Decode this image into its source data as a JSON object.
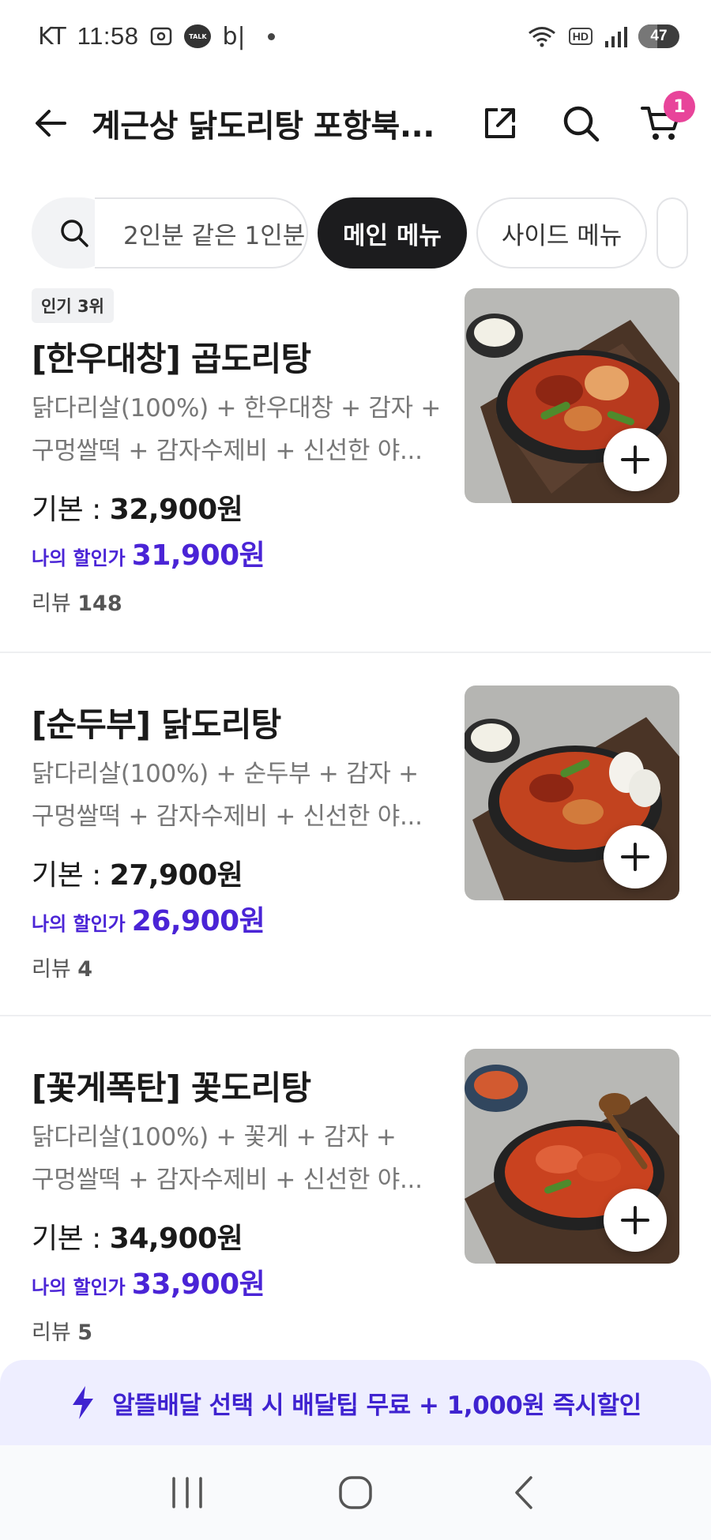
{
  "status_bar": {
    "carrier": "KT",
    "time": "11:58",
    "talk_label": "TALK",
    "app_label": "b|",
    "hd_label": "HD",
    "battery_level": "47"
  },
  "header": {
    "title": "계근상 닭도리탕 포항북...",
    "cart_count": "1"
  },
  "chips": {
    "items": [
      {
        "label": "2인분 같은 1인분."
      },
      {
        "label": "메인 메뉴"
      },
      {
        "label": "사이드 메뉴"
      }
    ],
    "active_index": 1
  },
  "menu": [
    {
      "rank": "인기 3위",
      "name": "[한우대창] 곱도리탕",
      "desc_line1": "닭다리살(100%) + 한우대창 + 감자 +",
      "desc_line2": "구멍쌀떡 + 감자수제비 + 신선한 야...",
      "base_label": "기본 : ",
      "base_price": "32,900원",
      "discount_label": "나의 할인가",
      "discount_price": "31,900원",
      "review_label": "리뷰 ",
      "review_count": "148"
    },
    {
      "rank": "",
      "name": "[순두부] 닭도리탕",
      "desc_line1": "닭다리살(100%) + 순두부 + 감자 +",
      "desc_line2": "구멍쌀떡 + 감자수제비 + 신선한 야...",
      "base_label": "기본 : ",
      "base_price": "27,900원",
      "discount_label": "나의 할인가",
      "discount_price": "26,900원",
      "review_label": "리뷰 ",
      "review_count": "4"
    },
    {
      "rank": "",
      "name": "[꽃게폭탄] 꽃도리탕",
      "desc_line1": "닭다리살(100%) + 꽃게 + 감자 +",
      "desc_line2": "구멍쌀떡 + 감자수제비 + 신선한 야...",
      "base_label": "기본 : ",
      "base_price": "34,900원",
      "discount_label": "나의 할인가",
      "discount_price": "33,900원",
      "review_label": "리뷰 ",
      "review_count": "5"
    }
  ],
  "promo": {
    "text": "알뜰배달 선택 시 배달팁 무료 + 1,000원 즉시할인"
  },
  "colors": {
    "accent_purple": "#4a24d6",
    "cart_badge": "#e8449a",
    "active_chip": "#1c1c1e",
    "promo_bg": "#eeeeff"
  },
  "icons": {
    "back": "arrow-left-icon",
    "share": "share-icon",
    "search": "search-icon",
    "cart": "cart-icon",
    "add": "plus-icon",
    "bolt": "lightning-icon",
    "nav_recent": "recent-apps-icon",
    "nav_home": "home-icon",
    "nav_back": "chevron-left-icon"
  }
}
